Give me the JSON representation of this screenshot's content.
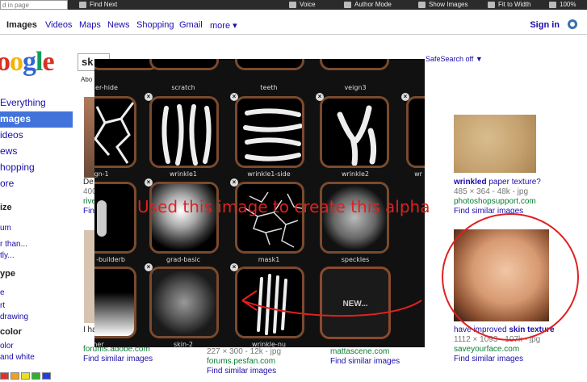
{
  "topbar": {
    "find_placeholder": "d in page",
    "find_next": "Find Next",
    "voice": "Voice",
    "author_mode": "Author Mode",
    "show_images": "Show Images",
    "fit_to_width": "Fit to Width",
    "zoom": "100%"
  },
  "nav": {
    "items": [
      "Images",
      "Videos",
      "Maps",
      "News",
      "Shopping",
      "Gmail",
      "more ▾"
    ],
    "sign_in": "Sign in"
  },
  "logo": "oogle",
  "search": {
    "value": "sk",
    "safesearch": "SafeSearch off ▼",
    "about": "Abo"
  },
  "sidebar": {
    "items": [
      "Everything",
      "mages",
      "ideos",
      "ews",
      "hopping",
      "ore"
    ],
    "size_header": "ize",
    "size_items": [
      "um",
      "r than...",
      "tly..."
    ],
    "type_header": "ype",
    "type_items": [
      "e",
      "rt",
      "drawing"
    ],
    "color_header": "color",
    "color_items": [
      "olor",
      "and white"
    ],
    "swatch_colors": [
      "#e03030",
      "#f0a020",
      "#e8e020",
      "#30b030",
      "#2040e0"
    ]
  },
  "panel": {
    "row0_labels": [
      "er-hide",
      "scratch",
      "teeth",
      "veign3"
    ],
    "row1_labels": [
      "eign-1",
      "wrinkle1",
      "wrinkle1-side",
      "wrinkle2",
      "wr"
    ],
    "row2_labels": [
      "-builderb",
      "grad-basic",
      "mask1",
      "speckles"
    ],
    "row3_labels": [
      "ner",
      "skin-2",
      "wrinkle-nu"
    ],
    "new_label": "NEW..."
  },
  "annotation": "Used this image to create this alpha",
  "results": {
    "r1": {
      "title_pre": "",
      "title_bold": "wrinkled",
      "title_post": " paper texture?",
      "meta": "485 × 364 - 48k - jpg",
      "url": "photoshopsupport.com",
      "similar": "Find similar images"
    },
    "r2": {
      "title_pre": "have improved ",
      "title_bold": "skin texture",
      "meta": "1112 × 1093 - 107k - jpg",
      "url": "saveyourface.com",
      "similar": "Find similar images"
    },
    "left_snip": {
      "a": "De",
      "b": "400",
      "c": "rive",
      "d": "Fin"
    },
    "bottom": {
      "col1": [
        "I ha",
        "forums.adobe.com",
        "Find similar images"
      ],
      "col2": [
        "227 × 300 - 12k - jpg",
        "forums.pesfan.com",
        "Find similar images"
      ],
      "col3": [
        "mattascene.com",
        "Find similar images"
      ]
    }
  }
}
